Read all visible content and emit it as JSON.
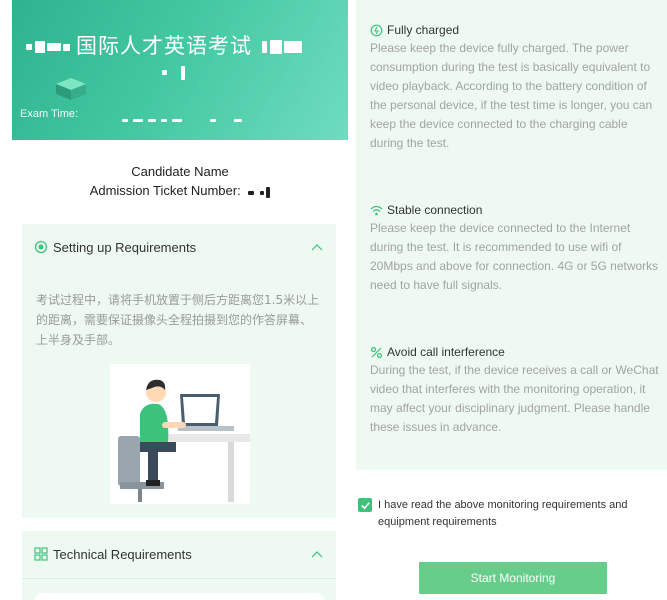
{
  "banner": {
    "title": "国际人才英语考试",
    "exam_time_label": "Exam Time:"
  },
  "candidate": {
    "name_label": "Candidate Name",
    "ticket_label": "Admission Ticket Number:"
  },
  "setup_card": {
    "title": "Setting up Requirements",
    "body": "考试过程中，请将手机放置于侧后方距离您1.5米以上的距离，需要保证摄像头全程拍摄到您的作答屏幕、上半身及手部。"
  },
  "tech_card": {
    "title": "Technical Requirements"
  },
  "requirements": [
    {
      "title": "Fully charged",
      "icon": "battery-charge-icon",
      "text": "Please keep the device fully charged. The power consumption during the test is basically equivalent to video playback. According to the battery condition of the personal device, if the test time is longer, you can keep the device connected to the charging cable during the test."
    },
    {
      "title": "Stable connection",
      "icon": "wifi-icon",
      "text": "Please keep the device connected to the Internet during the test. It is recommended to use wifi of 20Mbps and above for connection. 4G or 5G networks need to have full signals."
    },
    {
      "title": "Avoid call interference",
      "icon": "percent-icon",
      "text": "During the test, if the device receives a call or WeChat video that interferes with the monitoring operation, it may affect your disciplinary judgment. Please handle these issues in advance."
    }
  ],
  "agreement": {
    "checked": true,
    "text": "I have read the above monitoring requirements and equipment requirements"
  },
  "start_button": "Start Monitoring",
  "colors": {
    "accent": "#3cc27a",
    "button": "#66cd8a",
    "card_bg": "#eef9f2",
    "banner_start": "#2fb38f",
    "banner_end": "#6fdcbf"
  }
}
